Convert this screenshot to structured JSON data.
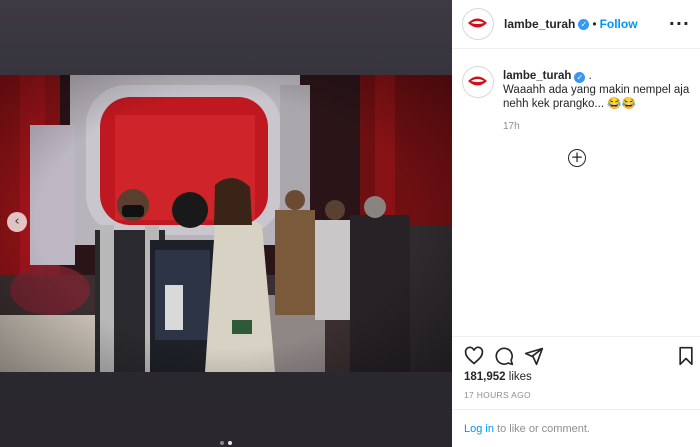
{
  "account": {
    "username": "lambe_turah",
    "verified_icon": "verified-badge-icon"
  },
  "header": {
    "follow_label": "Follow",
    "separator": "•",
    "more_label": "···"
  },
  "caption": {
    "username": "lambe_turah",
    "trailing": ".",
    "text": "Waaahh ada yang makin nempel aja nehh kek prangko... 😂😂",
    "relative_time": "17h"
  },
  "post": {
    "likes_count": "181,952",
    "likes_word": "likes",
    "timestamp": "17 HOURS AGO",
    "carousel": {
      "total": 2,
      "current": 2
    }
  },
  "footer": {
    "login_link": "Log in",
    "login_rest": " to like or comment."
  },
  "icons": {
    "prev": "chevron-left-icon",
    "load_more": "plus-circle-icon",
    "like": "heart-icon",
    "comment": "comment-icon",
    "share": "send-icon",
    "save": "bookmark-icon"
  },
  "colors": {
    "link_blue": "#0095f6",
    "verified": "#3897f0",
    "backdrop": "#2b2930"
  }
}
